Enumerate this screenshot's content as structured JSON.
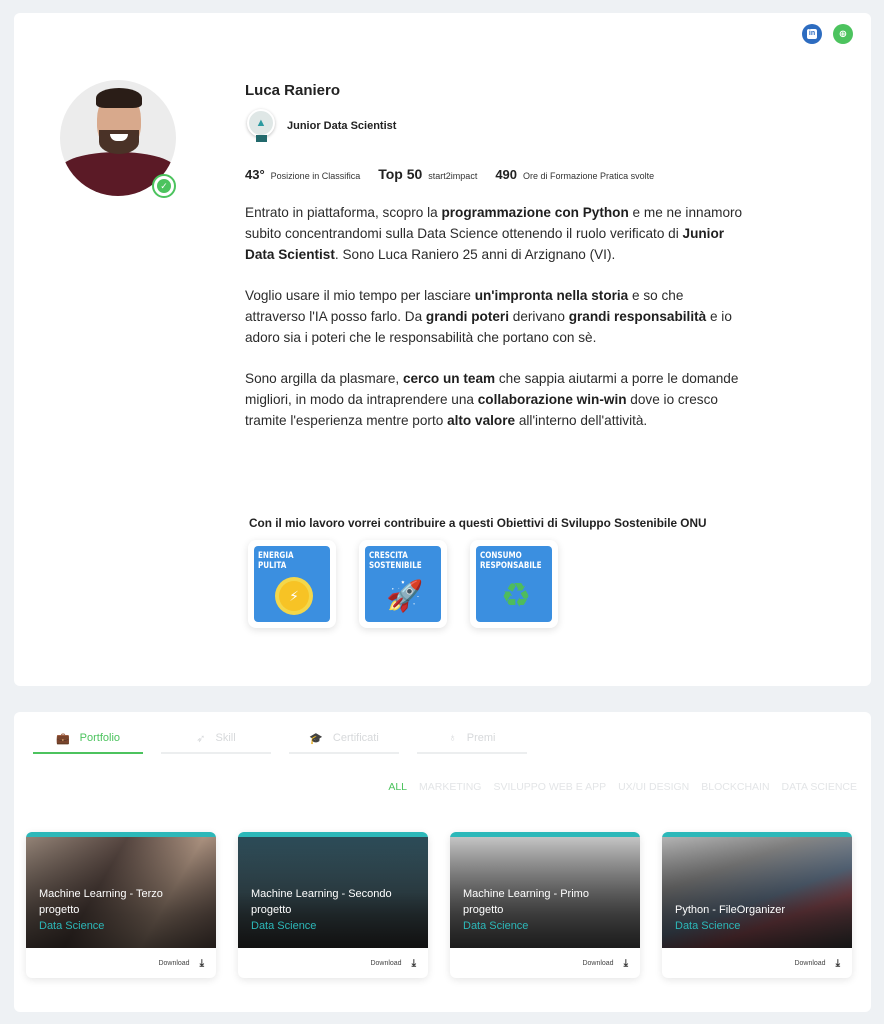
{
  "profile": {
    "name": "Luca Raniero",
    "role": "Junior Data Scientist",
    "social": [
      {
        "name": "linkedin",
        "glyph": "in"
      },
      {
        "name": "website",
        "glyph": "⊕"
      }
    ],
    "stats": [
      {
        "value": "43°",
        "label": "Posizione in Classifica"
      },
      {
        "value": "Top 50",
        "label": "start2impact"
      },
      {
        "value": "490",
        "label": "Ore di Formazione Pratica svolte"
      }
    ],
    "bio": [
      [
        {
          "t": "Entrato in piattaforma, scopro la "
        },
        {
          "t": "programmazione con Python",
          "b": true
        },
        {
          "t": " e me ne innamoro subito concentrandomi sulla Data Science ottenendo il ruolo verificato di "
        },
        {
          "t": "Junior Data Scientist",
          "b": true
        },
        {
          "t": ". Sono Luca Raniero 25 anni di Arzignano (VI)."
        }
      ],
      [
        {
          "t": "Voglio usare il mio tempo per lasciare "
        },
        {
          "t": "un'impronta nella storia",
          "b": true
        },
        {
          "t": " e so che attraverso l'IA posso farlo. Da "
        },
        {
          "t": "grandi poteri",
          "b": true
        },
        {
          "t": " derivano "
        },
        {
          "t": "grandi responsabilità",
          "b": true
        },
        {
          "t": " e io adoro sia i poteri che le responsabilità che portano con sè."
        }
      ],
      [
        {
          "t": "Sono argilla da plasmare, "
        },
        {
          "t": "cerco un team",
          "b": true
        },
        {
          "t": " che sappia aiutarmi a porre le domande migliori, in modo da intraprendere una "
        },
        {
          "t": "collaborazione win-win",
          "b": true
        },
        {
          "t": " dove io cresco tramite l'esperienza mentre porto "
        },
        {
          "t": "alto valore",
          "b": true
        },
        {
          "t": " all'interno dell'attività."
        }
      ]
    ],
    "sdg_title": "Con il mio lavoro vorrei contribuire a questi Obiettivi di Sviluppo Sostenibile ONU",
    "sdgs": [
      {
        "label_line1": "ENERGIA",
        "label_line2": "PULITA",
        "icon": "sun-icon",
        "color": "#3b8fe0"
      },
      {
        "label_line1": "CRESCITA",
        "label_line2": "SOSTENIBILE",
        "icon": "rocket-icon",
        "color": "#3b8fe0"
      },
      {
        "label_line1": "CONSUMO",
        "label_line2": "RESPONSABILE",
        "icon": "recycle-icon",
        "color": "#3b8fe0"
      }
    ]
  },
  "portfolio": {
    "tabs": [
      {
        "label": "Portfolio",
        "icon": "briefcase-icon",
        "active": true
      },
      {
        "label": "Skill",
        "icon": "rocket-icon",
        "active": false
      },
      {
        "label": "Certificati",
        "icon": "graduation-cap-icon",
        "active": false
      },
      {
        "label": "Premi",
        "icon": "award-icon",
        "active": false
      }
    ],
    "filters": [
      {
        "label": "ALL",
        "active": true
      },
      {
        "label": "MARKETING",
        "active": false
      },
      {
        "label": "SVILUPPO WEB E APP",
        "active": false
      },
      {
        "label": "UX/UI DESIGN",
        "active": false
      },
      {
        "label": "BLOCKCHAIN",
        "active": false
      },
      {
        "label": "DATA SCIENCE",
        "active": false
      }
    ],
    "projects": [
      {
        "title": "Machine Learning - Terzo progetto",
        "category": "Data Science",
        "download": "Download"
      },
      {
        "title": "Machine Learning - Secondo progetto",
        "category": "Data Science",
        "download": "Download"
      },
      {
        "title": "Machine Learning - Primo progetto",
        "category": "Data Science",
        "download": "Download"
      },
      {
        "title": "Python - FileOrganizer",
        "category": "Data Science",
        "download": "Download"
      }
    ]
  },
  "colors": {
    "accent_green": "#4cc35e",
    "teal": "#2cb8b9",
    "linkedin_blue": "#2d6cc0",
    "sdg_blue": "#3b8fe0",
    "page_bg": "#eef1f4"
  }
}
